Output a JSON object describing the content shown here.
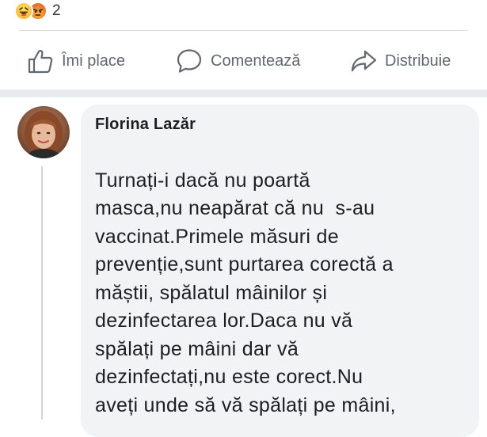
{
  "post": {
    "reaction_icons": [
      "haha-reaction-icon",
      "angry-reaction-icon"
    ],
    "reaction_count": "2"
  },
  "actions": {
    "like_label": "Îmi place",
    "comment_label": "Comentează",
    "share_label": "Distribuie"
  },
  "comment": {
    "author": "Florina Lazăr",
    "text_lines": [
      "Turnați-i dacă nu poartă",
      "masca,nu neapărat că nu  s-au",
      "vaccinat.Primele măsuri de",
      "prevenție,sunt purtarea corectă a",
      "măștii, spălatul mâinilor și",
      "dezinfectarea lor.Daca nu vă",
      "spălați pe mâini dar vă",
      "dezinfectați,nu este corect.Nu",
      "aveți unde să vă spălați pe mâini,"
    ]
  },
  "colors": {
    "action_text": "#626770",
    "bubble_bg": "#f2f3f5",
    "separator_band": "#e9ebee"
  }
}
